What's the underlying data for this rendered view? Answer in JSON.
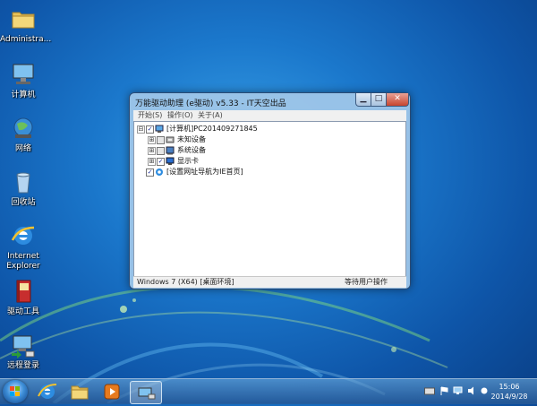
{
  "desktop": {
    "icons": [
      {
        "label": "Administra...",
        "icon": "folder-icon"
      },
      {
        "label": "计算机",
        "icon": "computer-icon"
      },
      {
        "label": "网络",
        "icon": "network-globe-icon"
      },
      {
        "label": "回收站",
        "icon": "recycle-bin-icon"
      },
      {
        "label": "Internet Explorer",
        "icon": "internet-explorer-icon"
      },
      {
        "label": "驱动工具",
        "icon": "driver-tools-book-icon"
      },
      {
        "label": "远程登录",
        "icon": "remote-login-icon"
      }
    ]
  },
  "window": {
    "title": "万能驱动助理 (e驱动) v5.33 - IT天空出品",
    "controls": {
      "minimize": "▁",
      "maximize": "□",
      "close": "✕"
    },
    "menu": [
      "开始(S)",
      "操作(O)",
      "关于(A)"
    ],
    "tree": {
      "root": {
        "label": "[计算机]PC201409271845",
        "expander": "⊟",
        "checked": true
      },
      "children": [
        {
          "label": "未知设备",
          "expander": "⊞",
          "checked": false
        },
        {
          "label": "系统设备",
          "expander": "⊞",
          "checked": false
        },
        {
          "label": "显示卡",
          "expander": "⊞",
          "checked": true
        }
      ],
      "extra": {
        "label": "[设置网址导航为IE首页]",
        "checked": true
      }
    },
    "status": {
      "left": "Windows 7 (X64) [桌面环境]",
      "right": "等待用户操作"
    }
  },
  "taskbar": {
    "apps": [
      {
        "icon": "internet-explorer-icon"
      },
      {
        "icon": "file-explorer-icon"
      },
      {
        "icon": "media-player-icon"
      },
      {
        "icon": "driver-assistant-icon",
        "active": true
      }
    ],
    "tray_icons": [
      "keyboard-icon",
      "action-center-flag-icon",
      "network-icon",
      "speaker-icon",
      "ime-icon"
    ],
    "clock": {
      "time": "15:06",
      "date": "2014/9/28"
    }
  },
  "colors": {
    "desktop": "#1b78cc",
    "window_frame": "#a2c8e9",
    "close_button": "#c7452f"
  }
}
